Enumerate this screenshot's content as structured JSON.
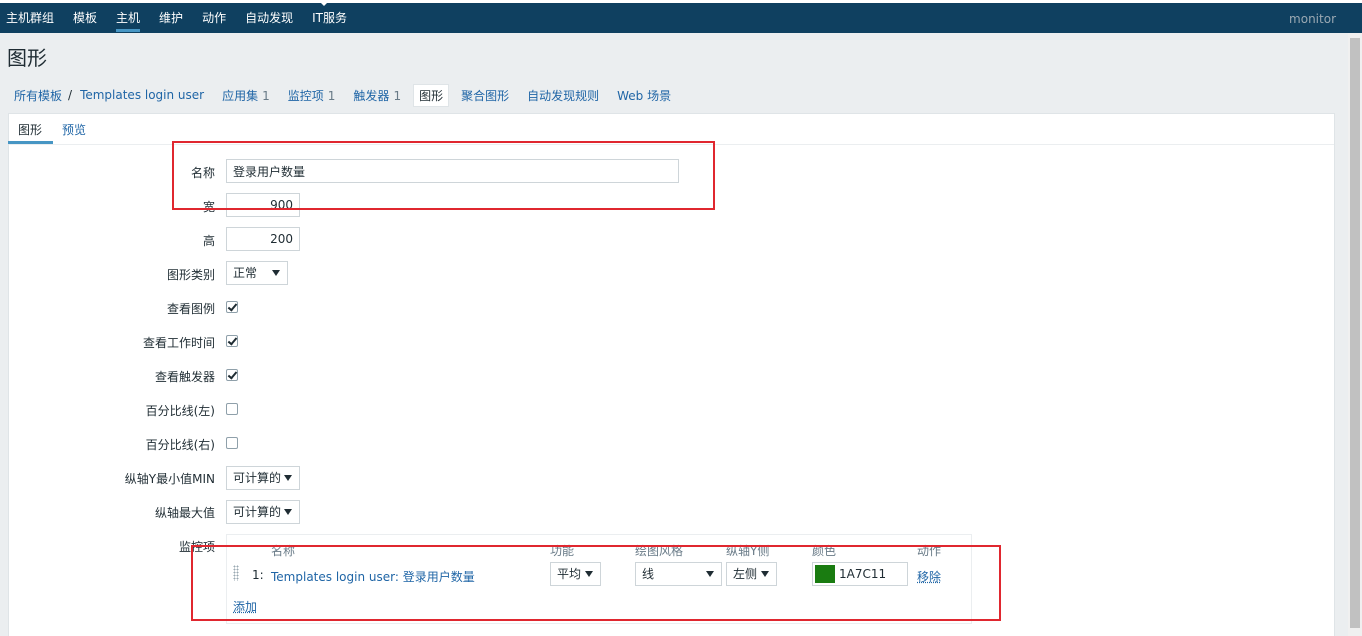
{
  "topnav": {
    "items": [
      "主机群组",
      "模板",
      "主机",
      "维护",
      "动作",
      "自动发现",
      "IT服务"
    ],
    "active_index": 2,
    "user": "monitor"
  },
  "page": {
    "title": "图形"
  },
  "subnav": {
    "all_templates": "所有模板",
    "separator": "/",
    "template_name": "Templates login user",
    "applications": {
      "label": "应用集",
      "count": "1"
    },
    "items": {
      "label": "监控项",
      "count": "1"
    },
    "triggers": {
      "label": "触发器",
      "count": "1"
    },
    "graphs_current": "图形",
    "screens": "聚合图形",
    "discovery": "自动发现规则",
    "web": "Web 场景"
  },
  "tabs": {
    "graph": "图形",
    "preview": "预览"
  },
  "form": {
    "name_label": "名称",
    "name_value": "登录用户数量",
    "width_label": "宽",
    "width_value": "900",
    "height_label": "高",
    "height_value": "200",
    "graph_type_label": "图形类别",
    "graph_type_value": "正常",
    "show_legend_label": "查看图例",
    "show_legend": true,
    "show_working_time_label": "查看工作时间",
    "show_working_time": true,
    "show_triggers_label": "查看触发器",
    "show_triggers": true,
    "percentile_left_label": "百分比线(左)",
    "percentile_left": false,
    "percentile_right_label": "百分比线(右)",
    "percentile_right": false,
    "ymin_label": "纵轴Y最小值MIN",
    "ymin_value": "可计算的",
    "ymax_label": "纵轴最大值",
    "ymax_value": "可计算的",
    "items_label": "监控项"
  },
  "items_table": {
    "headers": {
      "name": "名称",
      "function": "功能",
      "draw_style": "绘图风格",
      "y_side": "纵轴Y侧",
      "color": "颜色",
      "action": "动作"
    },
    "rows": [
      {
        "index": "1:",
        "name": "Templates login user: 登录用户数量",
        "function": "平均",
        "draw_style": "线",
        "y_side": "左侧",
        "color": "1A7C11",
        "color_hex": "#1a7c11",
        "remove": "移除"
      }
    ],
    "add": "添加"
  }
}
